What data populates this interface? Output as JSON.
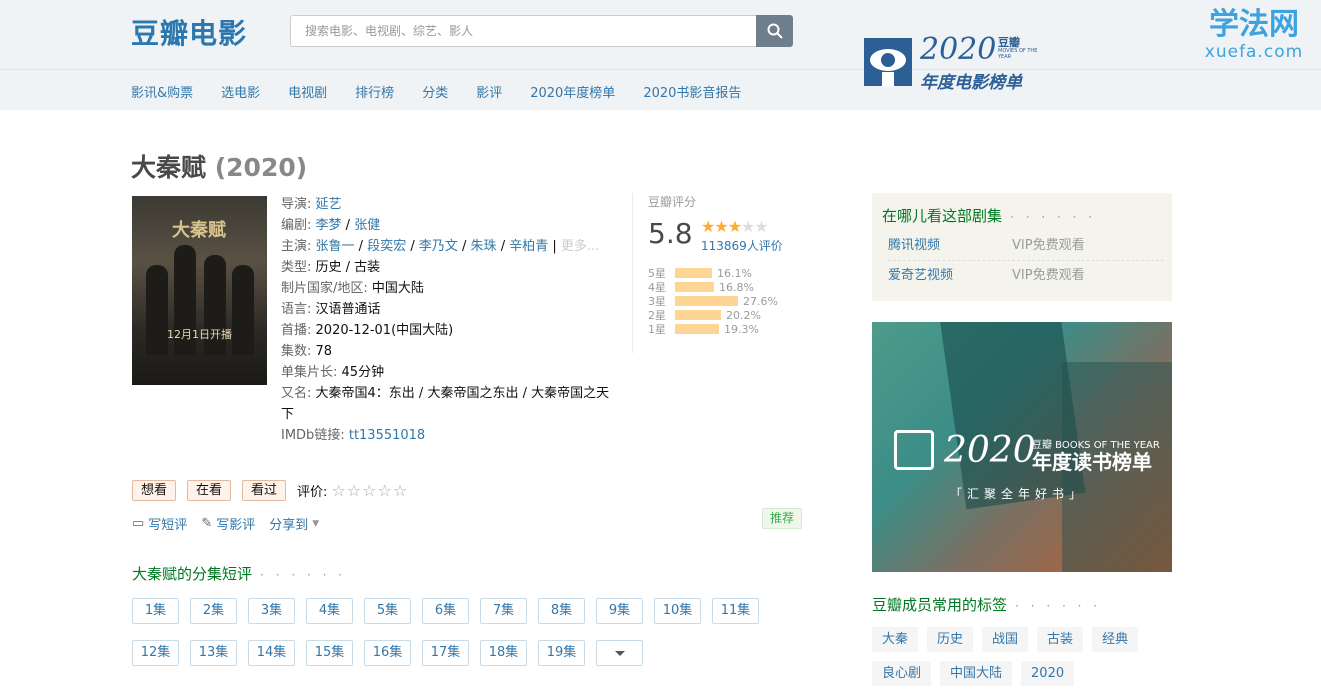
{
  "header": {
    "logo": "豆瓣电影",
    "search_placeholder": "搜索电影、电视剧、综艺、影人",
    "nav": [
      "影讯&购票",
      "选电影",
      "电视剧",
      "排行榜",
      "分类",
      "影评",
      "2020年度榜单",
      "2020书影音报告"
    ],
    "promo": {
      "year": "2020",
      "brand": "豆瓣",
      "sub": "MOVIES OF THE YEAR",
      "title": "年度电影榜单"
    },
    "watermark": {
      "cn": "学法网",
      "en": "xuefa.com"
    }
  },
  "movie": {
    "title": "大秦赋",
    "year": "(2020)",
    "poster_text": "12月1日开播",
    "poster_logo": "大秦赋",
    "info": {
      "director_label": "导演:",
      "director": "延艺",
      "writer_label": "编剧:",
      "writers": [
        "李梦",
        "张健"
      ],
      "cast_label": "主演:",
      "cast": [
        "张鲁一",
        "段奕宏",
        "李乃文",
        "朱珠",
        "辛柏青"
      ],
      "cast_more": "更多...",
      "genre_label": "类型:",
      "genre": "历史 / 古装",
      "country_label": "制片国家/地区:",
      "country": "中国大陆",
      "language_label": "语言:",
      "language": "汉语普通话",
      "premiere_label": "首播:",
      "premiere": "2020-12-01(中国大陆)",
      "episodes_label": "集数:",
      "episodes": "78",
      "runtime_label": "单集片长:",
      "runtime": "45分钟",
      "aka_label": "又名:",
      "aka": "大秦帝国4：东出 / 大秦帝国之东出 / 大秦帝国之天下",
      "imdb_label": "IMDb链接:",
      "imdb": "tt13551018"
    }
  },
  "rating": {
    "label": "豆瓣评分",
    "score": "5.8",
    "stars_filled": 3,
    "votes": "113869人评价",
    "breakdown": [
      {
        "label": "5星",
        "percent": "16.1%",
        "value": 16.1
      },
      {
        "label": "4星",
        "percent": "16.8%",
        "value": 16.8
      },
      {
        "label": "3星",
        "percent": "27.6%",
        "value": 27.6
      },
      {
        "label": "2星",
        "percent": "20.2%",
        "value": 20.2
      },
      {
        "label": "1星",
        "percent": "19.3%",
        "value": 19.3
      }
    ]
  },
  "actions": {
    "want": "想看",
    "watching": "在看",
    "watched": "看过",
    "rate_label": "评价:",
    "short_review": "写短评",
    "long_review": "写影评",
    "share": "分享到",
    "recommend": "推荐"
  },
  "episode_reviews": {
    "heading": "大秦赋的分集短评",
    "dots": "· · · · · ·",
    "episodes": [
      "1集",
      "2集",
      "3集",
      "4集",
      "5集",
      "6集",
      "7集",
      "8集",
      "9集",
      "10集",
      "11集",
      "12集",
      "13集",
      "14集",
      "15集",
      "16集",
      "17集",
      "18集",
      "19集"
    ]
  },
  "watch": {
    "heading": "在哪儿看这部剧集",
    "dots": "· · · · · ·",
    "sources": [
      {
        "name": "腾讯视频",
        "fee": "VIP免费观看"
      },
      {
        "name": "爱奇艺视频",
        "fee": "VIP免费观看"
      }
    ]
  },
  "ad": {
    "year": "2020",
    "brand": "豆瓣 BOOKS OF THE YEAR",
    "title": "年度读书榜单",
    "slogan": "「汇聚全年好书」"
  },
  "tags": {
    "heading": "豆瓣成员常用的标签",
    "dots": "· · · · · ·",
    "items": [
      "大秦",
      "历史",
      "战国",
      "古装",
      "经典",
      "良心剧",
      "中国大陆",
      "2020"
    ]
  },
  "colors": {
    "link": "#3377aa",
    "section": "#007722",
    "star": "#ffac2d",
    "bar": "#ffd596"
  }
}
